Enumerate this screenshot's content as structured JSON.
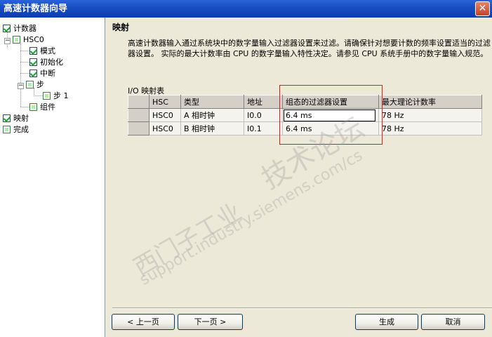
{
  "window": {
    "title": "高速计数器向导",
    "close_glyph": "✕"
  },
  "tree": {
    "items": [
      {
        "label": "计数器",
        "state": "checked"
      },
      {
        "label": "HSC0",
        "state": "empty",
        "expander": "−"
      },
      {
        "label": "模式",
        "state": "checked"
      },
      {
        "label": "初始化",
        "state": "checked"
      },
      {
        "label": "中断",
        "state": "checked"
      },
      {
        "label": "步",
        "state": "empty",
        "expander": "−"
      },
      {
        "label": "步 1",
        "state": "empty"
      },
      {
        "label": "组件",
        "state": "empty"
      },
      {
        "label": "映射",
        "state": "checked"
      },
      {
        "label": "完成",
        "state": "empty"
      }
    ]
  },
  "main": {
    "section_title": "映射",
    "description": "高速计数器输入通过系统块中的数字量输入过滤器设置来过滤。请确保针对想要计数的频率设置适当的过滤器设置。 实际的最大计数率由 CPU 的数字量输入特性决定。请参见 CPU 系统手册中的数字量输入规范。",
    "table_caption": "I/O 映射表",
    "table": {
      "headers": [
        "HSC",
        "类型",
        "地址",
        "组态的过滤器设置",
        "最大理论计数率"
      ],
      "rows": [
        [
          "HSC0",
          "A 相时钟",
          "I0.0",
          "6.4 ms",
          "78 Hz"
        ],
        [
          "HSC0",
          "B 相时钟",
          "I0.1",
          "6.4 ms",
          "78 Hz"
        ]
      ]
    }
  },
  "watermark": {
    "line1": "西门子工业",
    "line2": "support.industry.siemens.com/cs",
    "line3": "技术论坛"
  },
  "buttons": {
    "prev": "< 上一页",
    "next": "下一页 >",
    "generate": "生成",
    "cancel": "取消"
  },
  "colors": {
    "title_bar": "#0a3cb0",
    "highlight_border": "#e21c1c",
    "check_green": "#21a121"
  }
}
